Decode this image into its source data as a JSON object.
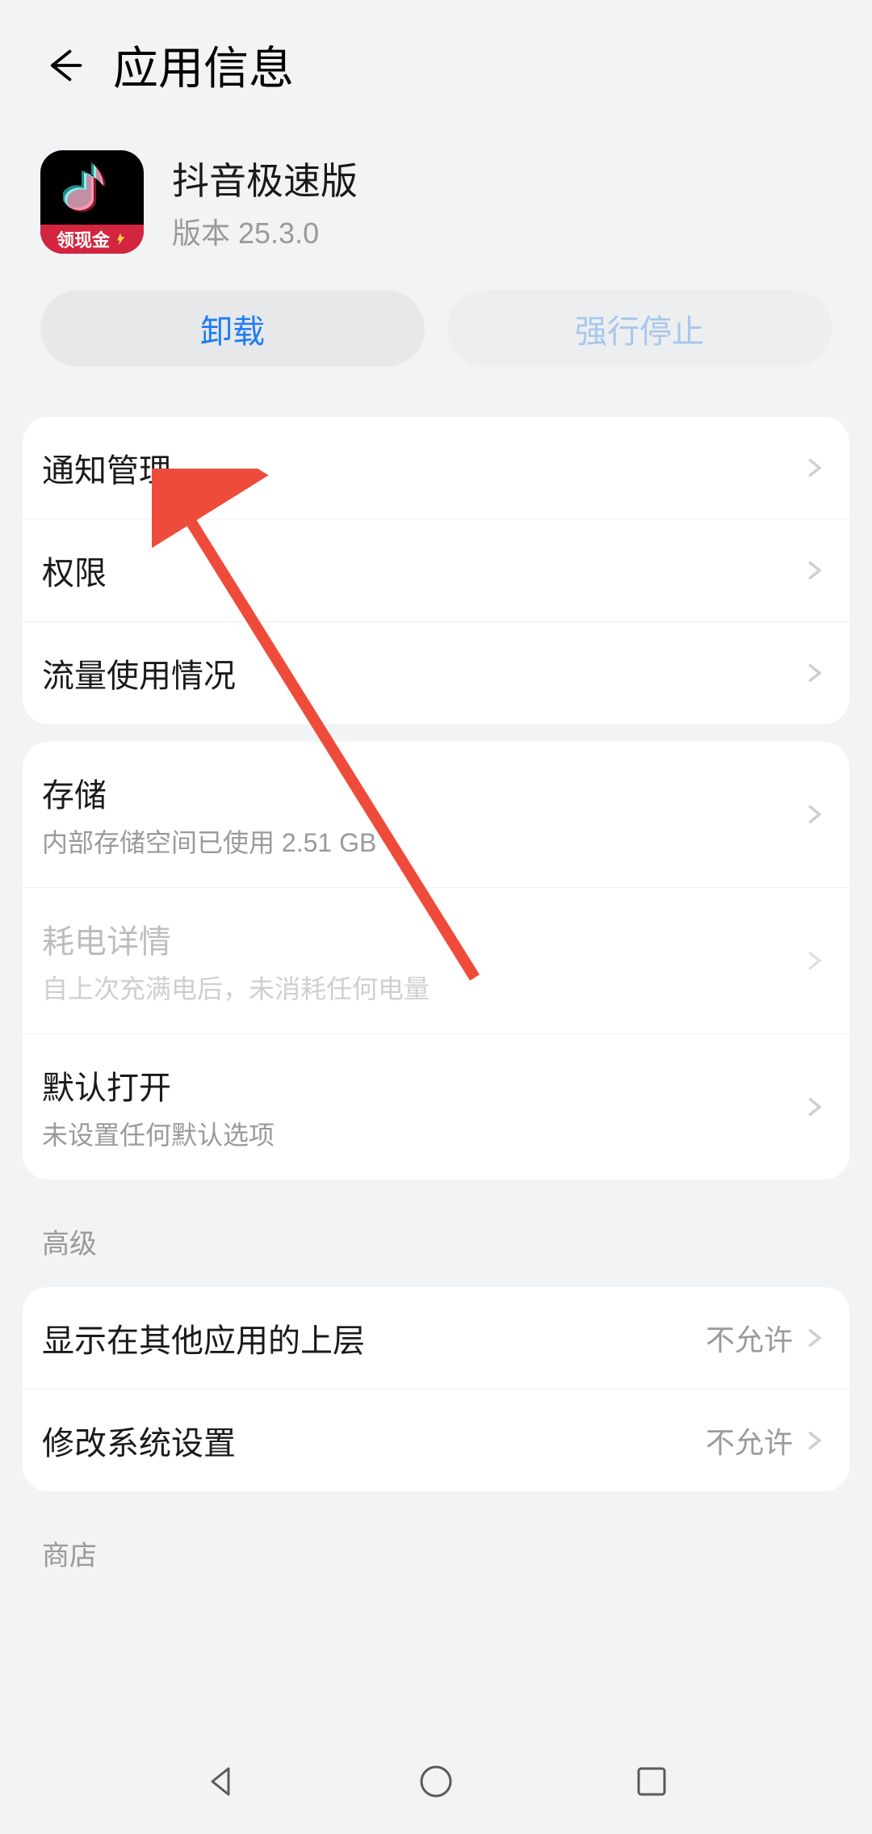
{
  "header": {
    "title": "应用信息"
  },
  "app": {
    "name": "抖音极速版",
    "version_label": "版本 25.3.0",
    "icon_badge": "领现金"
  },
  "actions": {
    "uninstall": "卸载",
    "force_stop": "强行停止"
  },
  "card1": {
    "notifications": "通知管理",
    "permissions": "权限",
    "data_usage": "流量使用情况"
  },
  "card2": {
    "storage": {
      "title": "存储",
      "sub": "内部存储空间已使用 2.51 GB"
    },
    "battery": {
      "title": "耗电详情",
      "sub": "自上次充满电后，未消耗任何电量"
    },
    "default_open": {
      "title": "默认打开",
      "sub": "未设置任何默认选项"
    }
  },
  "sections": {
    "advanced": "高级",
    "store": "商店"
  },
  "card3": {
    "overlay": {
      "title": "显示在其他应用的上层",
      "value": "不允许"
    },
    "modify_settings": {
      "title": "修改系统设置",
      "value": "不允许"
    }
  }
}
